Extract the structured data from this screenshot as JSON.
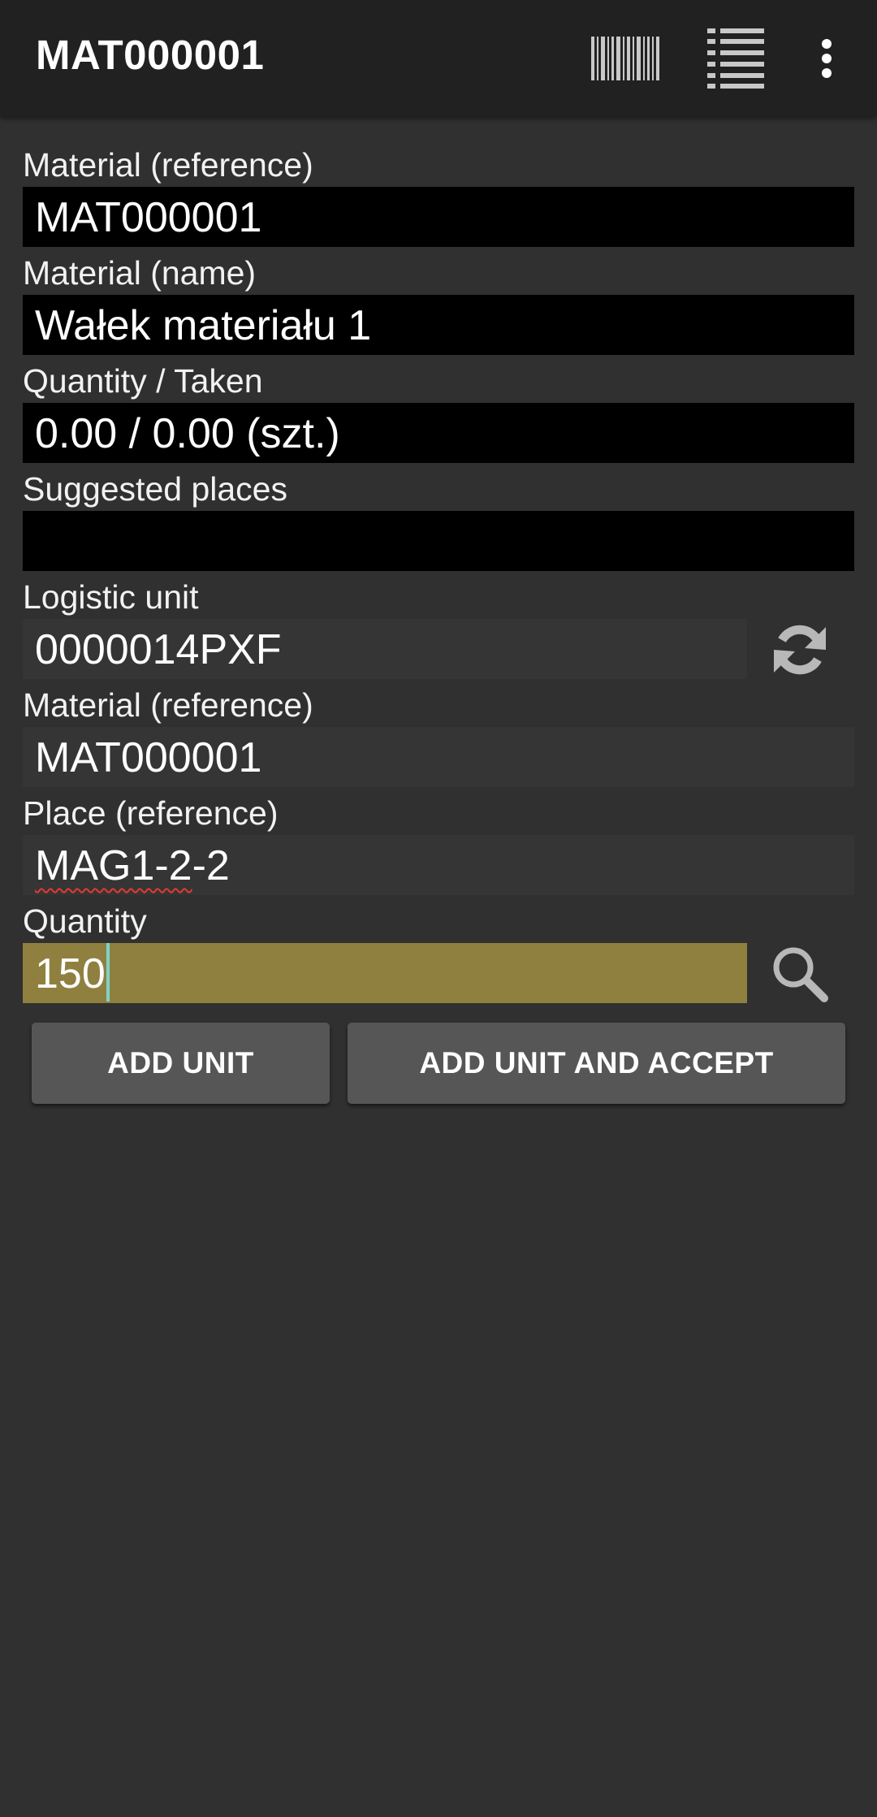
{
  "appbar": {
    "title": "MAT000001",
    "icons": {
      "barcode": "barcode-icon",
      "list": "list-icon",
      "more": "more-vertical-icon"
    }
  },
  "form": {
    "material_ref": {
      "label": "Material (reference)",
      "value": "MAT000001"
    },
    "material_name": {
      "label": "Material (name)",
      "value": "Wałek materiału 1"
    },
    "quantity_taken": {
      "label": "Quantity / Taken",
      "value": "0.00 / 0.00 (szt.)"
    },
    "suggested_places": {
      "label": "Suggested places",
      "value": ""
    },
    "logistic_unit": {
      "label": "Logistic unit",
      "value": "0000014PXF",
      "action_icon": "refresh-icon"
    },
    "material_ref_input": {
      "label": "Material (reference)",
      "value": "MAT000001"
    },
    "place_ref": {
      "label": "Place (reference)",
      "value_prefix": "MAG1-2",
      "value_suffix": "-2"
    },
    "quantity": {
      "label": "Quantity",
      "value": "150",
      "action_icon": "search-icon"
    }
  },
  "buttons": {
    "add_unit": "ADD UNIT",
    "add_unit_accept": "ADD UNIT AND ACCEPT"
  },
  "colors": {
    "appbar_bg": "#212121",
    "page_bg": "#303030",
    "focused_field_bg": "#908040",
    "cursor": "#7fd3c8",
    "button_bg": "#565656"
  }
}
